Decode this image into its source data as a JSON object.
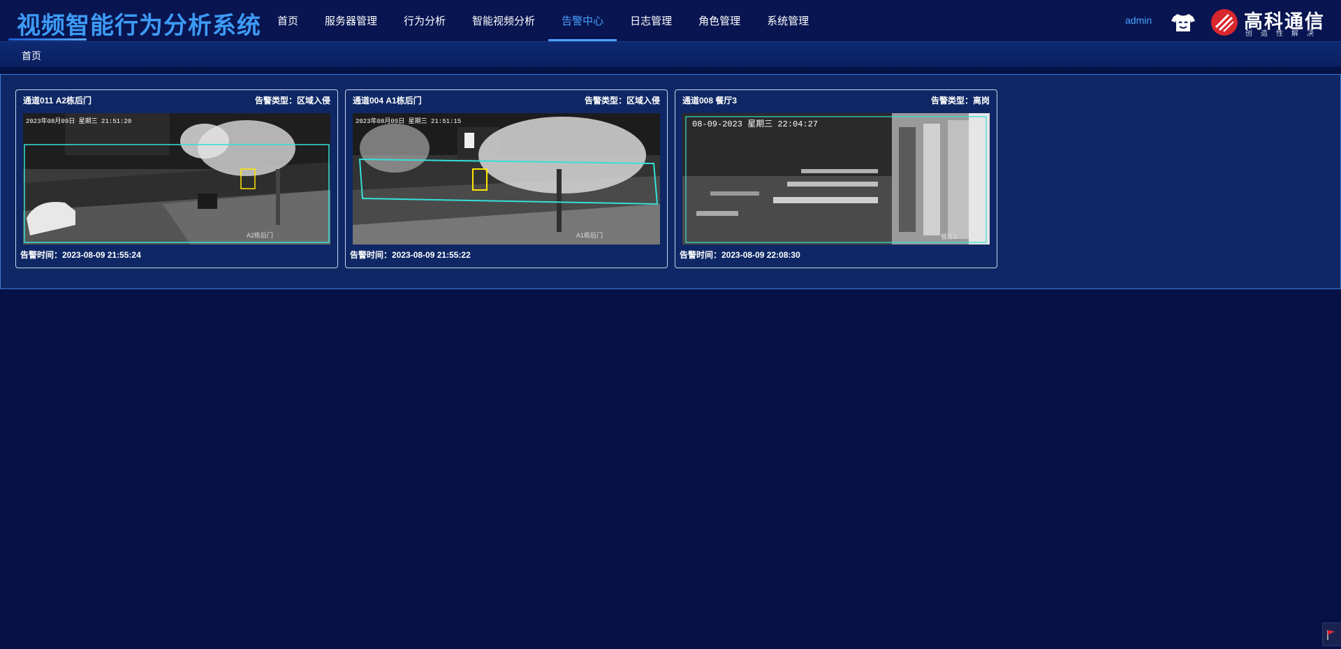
{
  "app": {
    "title": "视频智能行为分析系统"
  },
  "nav": {
    "items": [
      {
        "label": "首页"
      },
      {
        "label": "服务器管理"
      },
      {
        "label": "行为分析"
      },
      {
        "label": "智能视频分析"
      },
      {
        "label": "告警中心",
        "active": true
      },
      {
        "label": "日志管理"
      },
      {
        "label": "角色管理"
      },
      {
        "label": "系统管理"
      }
    ]
  },
  "user": {
    "name": "admin"
  },
  "brand": {
    "name": "高科通信",
    "slogan": "创造性解决"
  },
  "breadcrumb": {
    "label": "首页"
  },
  "alerts": [
    {
      "channel": "通道011   A2栋后门",
      "type": "告警类型：区域入侵",
      "time": "告警时间：2023-08-09 21:55:24",
      "osd": "2023年08月09日 星期三 21:51:20",
      "cam_label": "A2栋后门"
    },
    {
      "channel": "通道004   A1栋后门",
      "type": "告警类型：区域入侵",
      "time": "告警时间：2023-08-09 21:55:22",
      "osd": "2023年08月09日 星期三 21:51:15",
      "cam_label": "A1栋后门"
    },
    {
      "channel": "通道008   餐厅3",
      "type": "告警类型：离岗",
      "time": "告警时间：2023-08-09 22:08:30",
      "osd": "08-09-2023 星期三 22:04:27",
      "cam_label": "餐厅3"
    }
  ],
  "colors": {
    "accent": "#4aa3ff",
    "background": "#061145",
    "panel": "#0f2865",
    "roi_box": "#35e0d8",
    "target_box": "#ffe600"
  }
}
